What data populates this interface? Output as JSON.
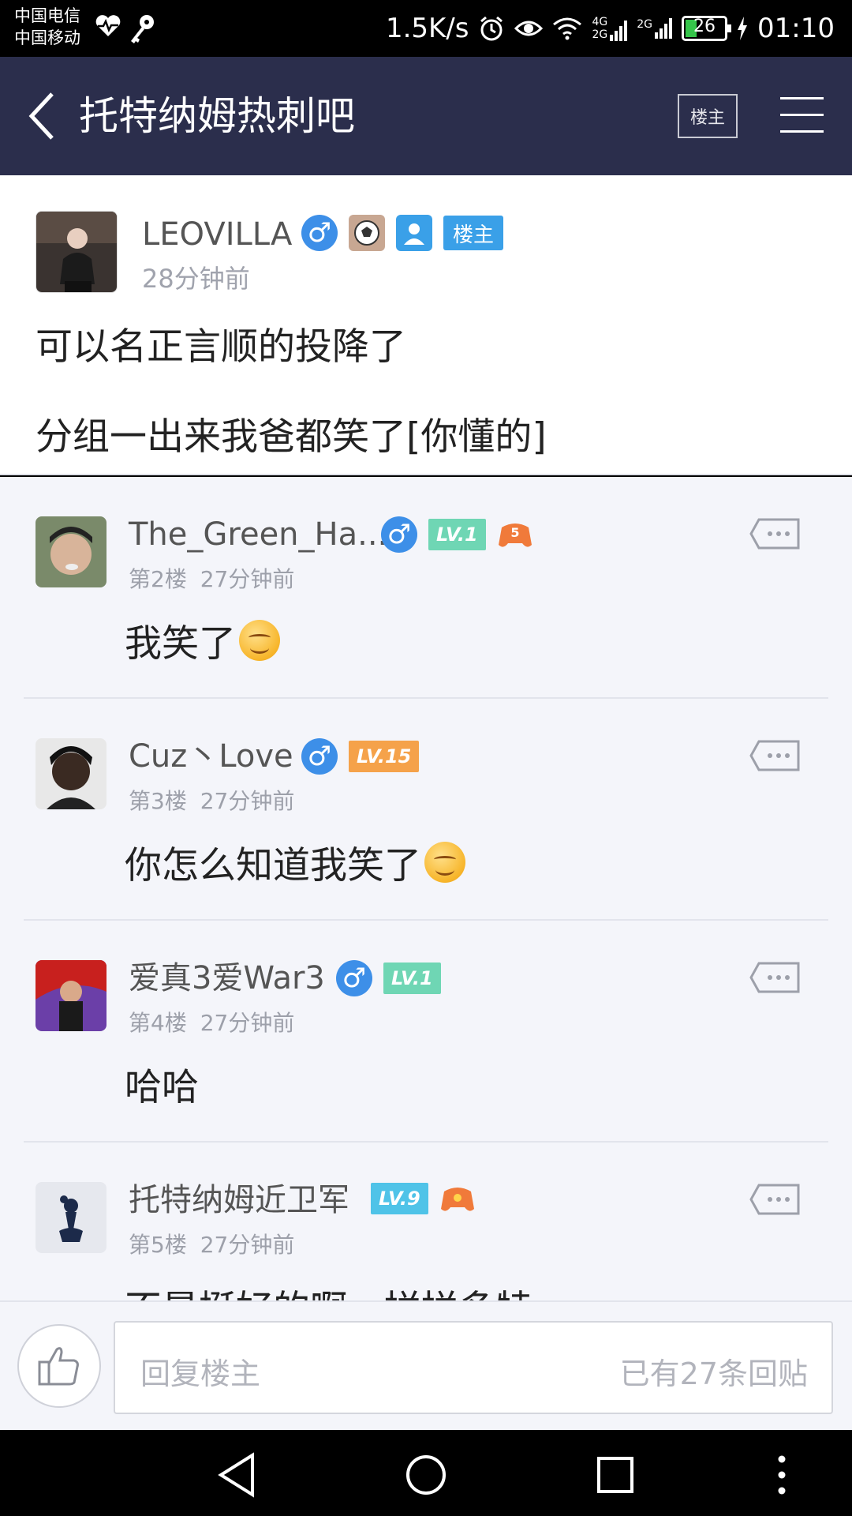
{
  "status_bar": {
    "carrier1": "中国电信",
    "carrier2": "中国移动",
    "speed": "1.5K/s",
    "net1": "4G",
    "net2": "2G",
    "net3": "2G",
    "battery": "26",
    "battery_level": 0.26,
    "time": "01:10"
  },
  "nav": {
    "title": "托特纳姆热刺吧",
    "owner_label": "楼主"
  },
  "main_post": {
    "author": "LEOVILLA",
    "owner_tag": "楼主",
    "time": "28分钟前",
    "line1": "可以名正言顺的投降了",
    "line2": "分组一出来我爸都笑了[你懂的]"
  },
  "replies": [
    {
      "name": "The_Green_Ha...",
      "floor": "第2楼",
      "time": "27分钟前",
      "level": "LV.1",
      "level_color": "#6fd6b4",
      "content": "我笑了",
      "emoji": true
    },
    {
      "name": "Cuz丶Love",
      "floor": "第3楼",
      "time": "27分钟前",
      "level": "LV.15",
      "level_color": "#f5a24a",
      "content": "你怎么知道我笑了",
      "emoji": true
    },
    {
      "name": "爱真3爱War3",
      "floor": "第4楼",
      "time": "27分钟前",
      "level": "LV.1",
      "level_color": "#6fd6b4",
      "content": "哈哈",
      "emoji": false
    },
    {
      "name": "托特纳姆近卫军",
      "floor": "第5楼",
      "time": "27分钟前",
      "level": "LV.9",
      "level_color": "#4fc3e8",
      "content": "不是挺好的啊，拼拼多特",
      "emoji": false
    }
  ],
  "reply_bar": {
    "placeholder": "回复楼主",
    "count": "已有27条回贴"
  },
  "colors": {
    "nav_bg": "#2b2e4c",
    "page_bg": "#f4f5fa",
    "accent": "#3d8fe8"
  }
}
